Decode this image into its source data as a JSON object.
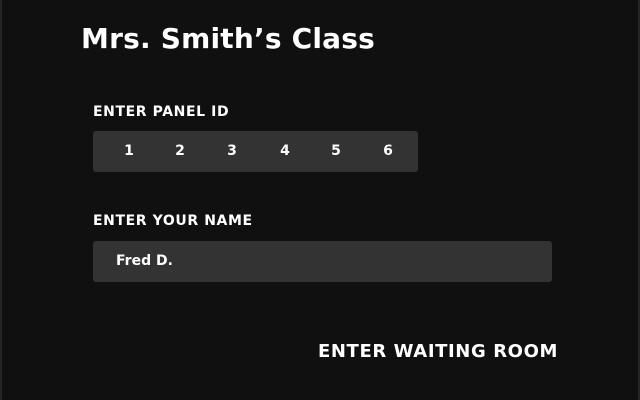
{
  "page": {
    "title": "Mrs. Smith’s Class"
  },
  "panel_id": {
    "label": "ENTER PANEL ID",
    "digits": [
      "1",
      "2",
      "3",
      "4",
      "5",
      "6"
    ]
  },
  "name": {
    "label": "ENTER YOUR NAME",
    "value": "Fred D."
  },
  "actions": {
    "enter_label": "ENTER WAITING ROOM"
  },
  "colors": {
    "background": "#101010",
    "field_background": "#333333",
    "text": "#ffffff"
  }
}
